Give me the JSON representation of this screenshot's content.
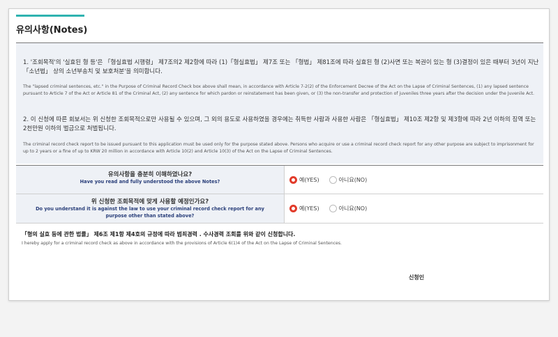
{
  "title": "유의사항(Notes)",
  "notes": {
    "note1_ko": "1. '조회목적'의 '실효된 형 등'은 「형실효법 시행령」 제7조의2 제2항에 따라 (1)「형실효법」 제7조 또는 「형법」 제81조에 따라 실효된 형 (2)사면 또는 복권이 있는 형 (3)결정이 있은 때부터 3년이 지난 「소년법」 상의 소년부송치 및 보호처분'을 의미합니다.",
    "note1_en": "The \"lapsed criminal sentences, etc.\" in the Purpose of Criminal Record Check box above shall mean, in accordance with Article 7-2(2) of the Enforcement Decree of the Act on the Lapse of Criminal Sentences, (1) any lapsed sentence pursuant to Article 7 of the Act or Article 81 of the Criminal Act, (2) any sentence for which pardon or reinstatement has been given, or (3) the non-transfer and protection of juveniles three years after the decision under the Juvenile Act.",
    "note2_ko": "2. 이 신청에 따른 회보서는 위 신청한 조회목적으로만 사용될 수 있으며, 그 외의 용도로 사용하였을 경우에는 취득한 사람과 사용한 사람은 「형실효법」 제10조 제2항 및 제3항에 따라 2년 이하의 징역 또는 2천만원 이하의 벌금으로 처벌됩니다.",
    "note2_en": "The criminal record check report to be issued pursuant to this application must be used only for the purpose stated above. Persons who acquire or use a criminal record check report for any other purpose are subject to imprisonment for up to 2 years or a fine of up to KRW 20 million in accordance with Article 10(2) and Article 10(3) of the Act on the Lapse of Criminal Sentences."
  },
  "questions": [
    {
      "ko": "유의사항을 충분히 이해하였나요?",
      "en": "Have you read and fully understood the above Notes?",
      "yes_label": "예(YES)",
      "no_label": "아니요(NO)",
      "selected": "yes"
    },
    {
      "ko": "위 신청한 조회목적에 맞게 사용할 예정인가요?",
      "en": "Do you understand it is against the law to use your criminal record check report for any purpose other than stated above?",
      "yes_label": "예(YES)",
      "no_label": "아니요(NO)",
      "selected": "yes"
    }
  ],
  "declaration": {
    "ko": "「형의 실효 등에 관한 법률」 제6조 제1항 제4호의 규정에 따라 범죄경력 . 수사경력 조회를 위와 같이 신청합니다.",
    "en": "I hereby apply for a criminal record check as above in accordance with the provisions of Article 6(1)4 of the Act on the Lapse of Criminal Sentences."
  },
  "applicant_label": "신청인",
  "colors": {
    "accent": "#2fb3b0",
    "notes_bg": "#eef1f6",
    "radio_selected": "#e23b2a"
  }
}
